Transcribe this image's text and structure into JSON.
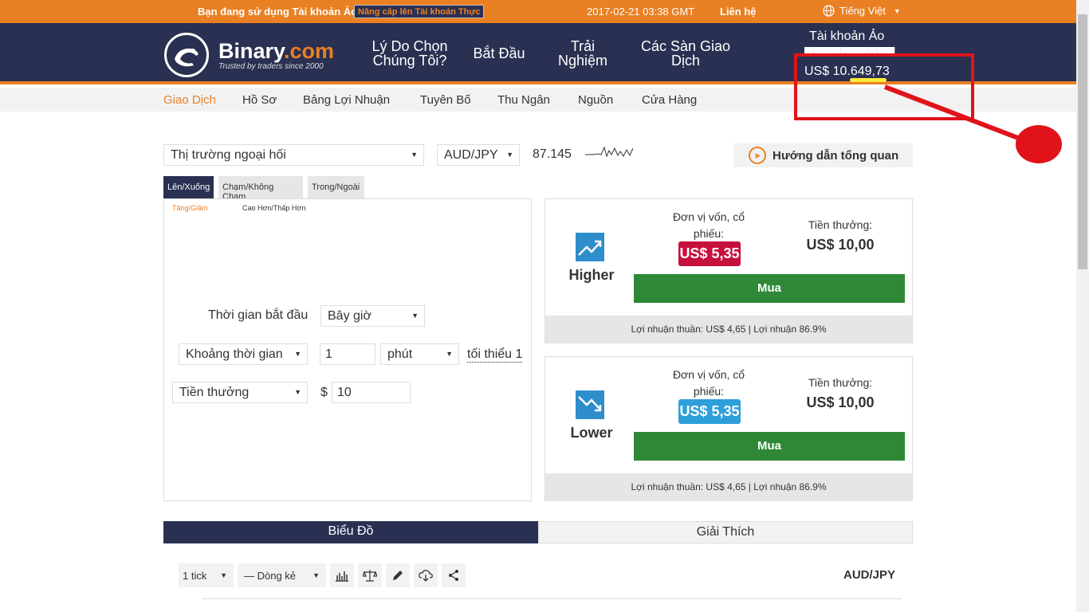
{
  "topbar": {
    "virtual_msg": "Bạn đang sử dụng Tài khoản Ảo.",
    "upgrade_label": "Nâng cấp lên Tài khoản Thực",
    "clock": "2017-02-21 03:38 GMT",
    "contact": "Liên hệ",
    "language": "Tiếng Việt"
  },
  "header": {
    "brand_name": "Binary",
    "brand_tld": ".com",
    "tagline": "Trusted by traders since 2000",
    "nav": [
      "Lý Do Chọn Chúng Tôi?",
      "Bắt Đầu",
      "Trải Nghiệm",
      "Các Sàn Giao Dịch"
    ],
    "account_title": "Tài khoản Ảo",
    "account_balance": "US$ 10.649,73"
  },
  "subnav": [
    "Giao Dịch",
    "Hồ Sơ",
    "Bảng Lợi Nhuận",
    "Tuyên Bố",
    "Thu Ngân",
    "Nguồn",
    "Cửa Hàng"
  ],
  "market": {
    "market_select": "Thị trường ngoại hối",
    "symbol_select": "AUD/JPY",
    "spot": "87.145",
    "guide_label": "Hướng dẫn tổng quan"
  },
  "tabs": [
    "Lên/Xuống",
    "Chạm/Không Chạm",
    "Trong/Ngoài"
  ],
  "subtabs": [
    "Tăng/Giảm",
    "Cao Hơn/Thấp Hơn"
  ],
  "form": {
    "start_label": "Thời gian bắt đầu",
    "start_value": "Bây giờ",
    "duration_type": "Khoảng thời gian",
    "duration_value": "1",
    "duration_unit": "phút",
    "duration_min": "tối thiểu 1",
    "amount_type": "Tiền thưởng",
    "currency_symbol": "$",
    "amount_value": "10"
  },
  "contracts": [
    {
      "name": "Higher",
      "stake_label": "Đơn vị vốn, cổ phiếu:",
      "price": "US$ 5,35",
      "price_color": "#c6103e",
      "payout_label": "Tiền thưởng:",
      "payout": "US$ 10,00",
      "buy_label": "Mua",
      "profit": "Lợi nhuận thuần: US$ 4,65 | Lợi nhuận 86.9%"
    },
    {
      "name": "Lower",
      "stake_label": "Đơn vị vốn, cổ phiếu:",
      "price": "US$ 5,35",
      "price_color": "#2e9fd8",
      "payout_label": "Tiền thưởng:",
      "payout": "US$ 10,00",
      "buy_label": "Mua",
      "profit": "Lợi nhuận thuần: US$ 4,65 | Lợi nhuận 86.9%"
    }
  ],
  "chart_tabs": [
    "Biểu Đồ",
    "Giải Thích"
  ],
  "chart_toolbar": {
    "interval": "1 tick",
    "line_type": "— Dòng kẻ",
    "symbol": "AUD/JPY"
  },
  "colors": {
    "orange": "#e98024",
    "navy": "#2a3052",
    "green": "#2e8836",
    "annotation_red": "#e0131b"
  }
}
